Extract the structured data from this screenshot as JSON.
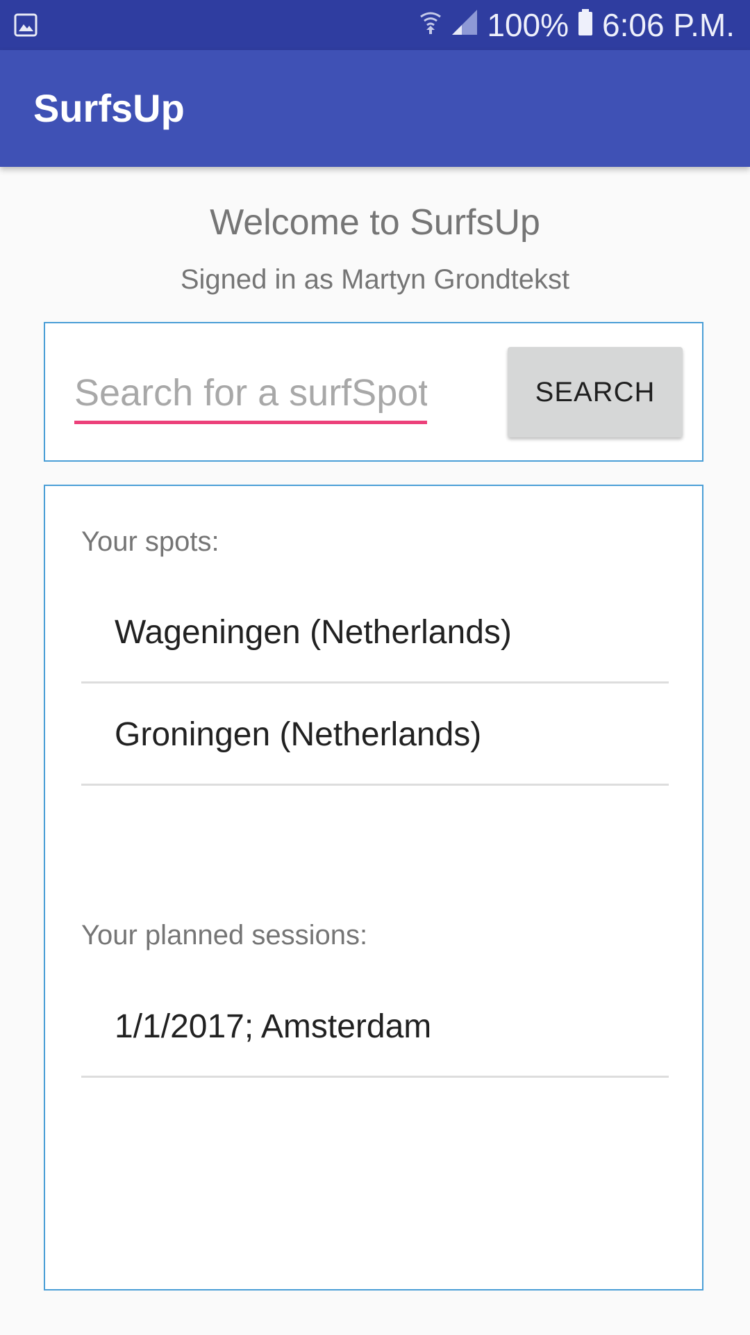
{
  "status_bar": {
    "battery": "100%",
    "time": "6:06 P.M.",
    "left_icon": "gallery-icon",
    "icons": [
      "wifi-icon",
      "signal-icon",
      "battery-icon"
    ]
  },
  "app_bar": {
    "title": "SurfsUp",
    "color": "#3f51b5"
  },
  "header": {
    "welcome": "Welcome to SurfsUp",
    "signed_in": "Signed in as Martyn Grondtekst"
  },
  "search": {
    "placeholder": "Search for a surfSpot",
    "value": "",
    "button_label": "SEARCH",
    "accent_color": "#ec407a"
  },
  "spots": {
    "label": "Your spots:",
    "items": [
      {
        "label": "Wageningen (Netherlands)"
      },
      {
        "label": "Groningen (Netherlands)"
      }
    ]
  },
  "sessions": {
    "label": "Your planned sessions:",
    "items": [
      {
        "label": "1/1/2017; Amsterdam"
      }
    ]
  }
}
